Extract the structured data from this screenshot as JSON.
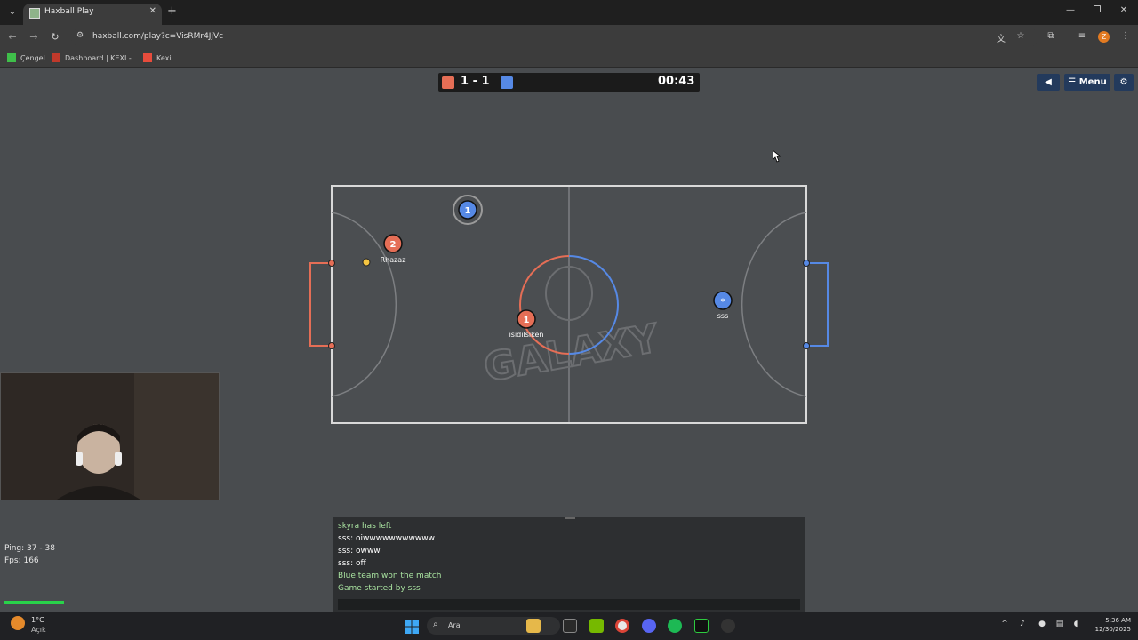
{
  "browser": {
    "tab_title": "Haxball Play",
    "url": "haxball.com/play?c=VisRMr4JjVc",
    "bookmarks": [
      {
        "label": "Çengel",
        "color": "#3fbf4a"
      },
      {
        "label": "Dashboard | KEXI -...",
        "color": "#c0392b"
      },
      {
        "label": "Kexi",
        "color": "#e74c3c"
      }
    ],
    "profile_initial": "Z"
  },
  "game": {
    "score": "1 - 1",
    "timer": "00:43",
    "red_color": "#e56e56",
    "blue_color": "#5689e5",
    "menu_label": "Menu",
    "players": [
      {
        "number": "1",
        "name": "",
        "team": "blue"
      },
      {
        "number": "2",
        "name": "Rhazaz",
        "team": "red"
      },
      {
        "number": "1",
        "name": "isidilsiken",
        "team": "red"
      },
      {
        "number": "*",
        "name": "sss",
        "team": "blue"
      }
    ],
    "field_logo": "GALAXY"
  },
  "stats": {
    "ping": "Ping: 37 - 38",
    "fps": "Fps: 166"
  },
  "chat": {
    "lines": [
      {
        "text": "skyra has left",
        "kind": "notice"
      },
      {
        "text": "sss: oiwwwwwwwwwww",
        "kind": "player"
      },
      {
        "text": "sss: owww",
        "kind": "player"
      },
      {
        "text": "sss: off",
        "kind": "player"
      },
      {
        "text": "Blue team won the match",
        "kind": "notice"
      },
      {
        "text": "Game started by sss",
        "kind": "notice"
      }
    ]
  },
  "taskbar": {
    "weather_temp": "1°C",
    "weather_cond": "Açık",
    "search_placeholder": "Ara",
    "time": "5:36 AM",
    "date": "12/30/2025"
  }
}
